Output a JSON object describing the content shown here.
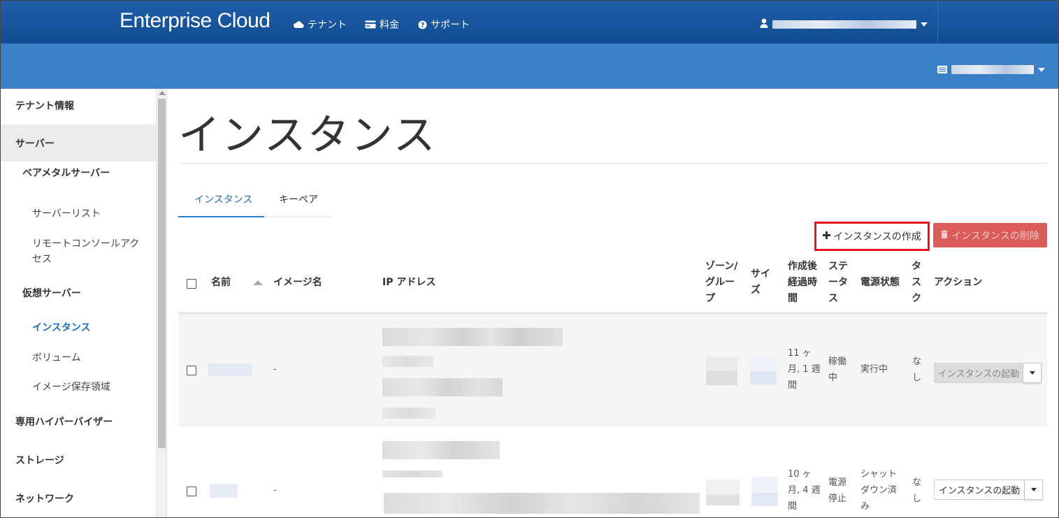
{
  "app": {
    "brand": "Enterprise Cloud"
  },
  "topnav": {
    "items": [
      {
        "label": "テナント",
        "icon": "cloud-icon"
      },
      {
        "label": "料金",
        "icon": "credit-card-icon"
      },
      {
        "label": "サポート",
        "icon": "question-circle-icon"
      }
    ],
    "user_icon": "user-icon"
  },
  "subnav": {
    "tenant_icon": "list-icon"
  },
  "sidebar": {
    "items": [
      {
        "label": "テナント情報",
        "level": 1
      },
      {
        "label": "サーバー",
        "level": 1
      },
      {
        "label": "ベアメタルサーバー",
        "level": 2
      },
      {
        "label": "サーバーリスト",
        "level": 3
      },
      {
        "label": "リモートコンソールアク",
        "label2": "セス",
        "level": 3
      },
      {
        "label": "仮想サーバー",
        "level": 2
      },
      {
        "label": "インスタンス",
        "level": 3,
        "current": true
      },
      {
        "label": "ボリューム",
        "level": 3
      },
      {
        "label": "イメージ保存領域",
        "level": 3
      },
      {
        "label": "専用ハイパーバイザー",
        "level": 1
      },
      {
        "label": "ストレージ",
        "level": 1
      },
      {
        "label": "ネットワーク",
        "level": 1
      }
    ]
  },
  "main": {
    "title": "インスタンス",
    "tabs": [
      {
        "label": "インスタンス",
        "active": true
      },
      {
        "label": "キーペア",
        "active": false
      }
    ],
    "buttons": {
      "create": "インスタンスの作成",
      "delete": "インスタンスの削除"
    }
  },
  "table": {
    "headers": {
      "name": "名前",
      "image": "イメージ名",
      "ip": "IP アドレス",
      "zone": [
        "ゾーン/",
        "グルー",
        "プ"
      ],
      "size": [
        "サイ",
        "ズ"
      ],
      "age": [
        "作成後",
        "経過時",
        "間"
      ],
      "status": [
        "ステ",
        "ータ",
        "ス"
      ],
      "power": "電源状態",
      "task": [
        "タ",
        "ス",
        "ク"
      ],
      "action": "アクション"
    },
    "rows": [
      {
        "image": "-",
        "age": [
          "11 ヶ",
          "月, 1 週",
          "間"
        ],
        "status": [
          "稼働",
          "中"
        ],
        "power": [
          "実行中"
        ],
        "task": [
          "な",
          "し"
        ],
        "action": "インスタンスの起動",
        "action_disabled": true
      },
      {
        "image": "-",
        "age": [
          "10 ヶ",
          "月, 4 週",
          "間"
        ],
        "status": [
          "電源",
          "停止"
        ],
        "power": [
          "シャット",
          "ダウン済",
          "み"
        ],
        "task": [
          "な",
          "し"
        ],
        "action": "インスタンスの起動",
        "action_disabled": false
      }
    ]
  },
  "colors": {
    "topbar": "#0f4c92",
    "subbar": "#3a80c6",
    "accent": "#1b6fb8",
    "danger": "#d9534f",
    "highlight": "#e8141b"
  }
}
